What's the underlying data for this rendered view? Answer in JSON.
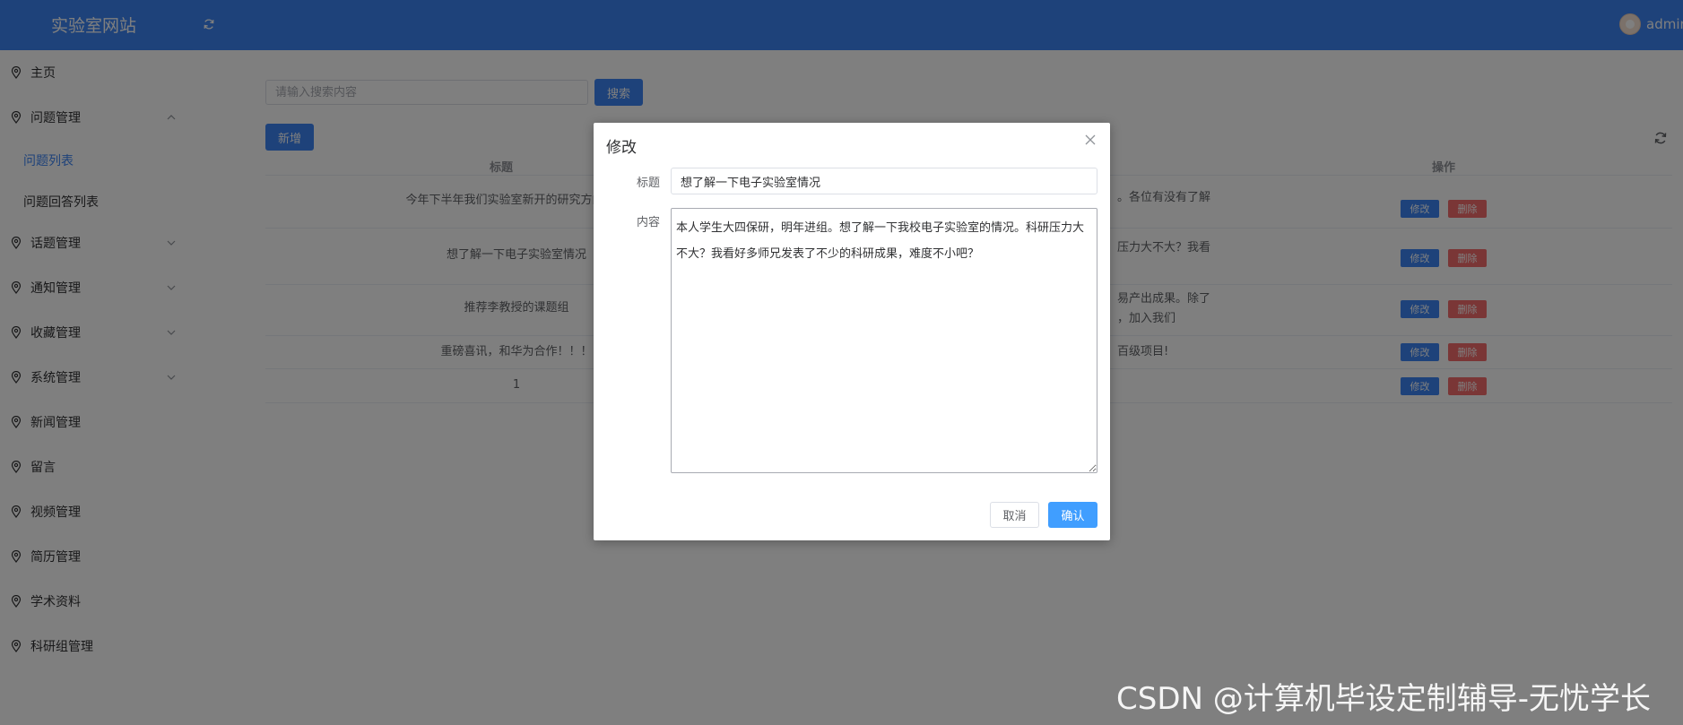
{
  "header": {
    "site_title": "实验室网站",
    "username": "admin"
  },
  "sidebar": {
    "items": [
      {
        "label": "主页"
      },
      {
        "label": "问题管理"
      },
      {
        "label": "问题列表"
      },
      {
        "label": "问题回答列表"
      },
      {
        "label": "话题管理"
      },
      {
        "label": "通知管理"
      },
      {
        "label": "收藏管理"
      },
      {
        "label": "系统管理"
      },
      {
        "label": "新闻管理"
      },
      {
        "label": "留言"
      },
      {
        "label": "视频管理"
      },
      {
        "label": "简历管理"
      },
      {
        "label": "学术资料"
      },
      {
        "label": "科研组管理"
      }
    ]
  },
  "toolbar": {
    "search_placeholder": "请输入搜索内容",
    "search_label": "搜索",
    "add_label": "新增"
  },
  "table": {
    "columns": [
      "标题",
      "操作"
    ],
    "rows": [
      {
        "title": "今年下半年我们实验室新开的研究方向有哪",
        "content_lines": [
          "。各位有没有了解"
        ]
      },
      {
        "title": "想了解一下电子实验室情况",
        "content_lines": [
          "压力大不大？我看"
        ]
      },
      {
        "title": "推荐李教授的课题组",
        "content_lines": [
          "易产出成果。除了",
          "，加入我们"
        ]
      },
      {
        "title": "重磅喜讯，和华为合作！！！",
        "content_lines": [
          "百级项目!"
        ]
      },
      {
        "title": "1",
        "content_lines": [
          ""
        ]
      }
    ],
    "edit_label": "修改",
    "delete_label": "删除"
  },
  "dialog": {
    "title": "修改",
    "title_label": "标题",
    "title_value": "想了解一下电子实验室情况",
    "content_label": "内容",
    "content_value": "本人学生大四保研，明年进组。想了解一下我校电子实验室的情况。科研压力大不大？我看好多师兄发表了不少的科研成果，难度不小吧？",
    "cancel_label": "取消",
    "confirm_label": "确认"
  },
  "watermark": "CSDN @计算机毕设定制辅导-无忧学长"
}
